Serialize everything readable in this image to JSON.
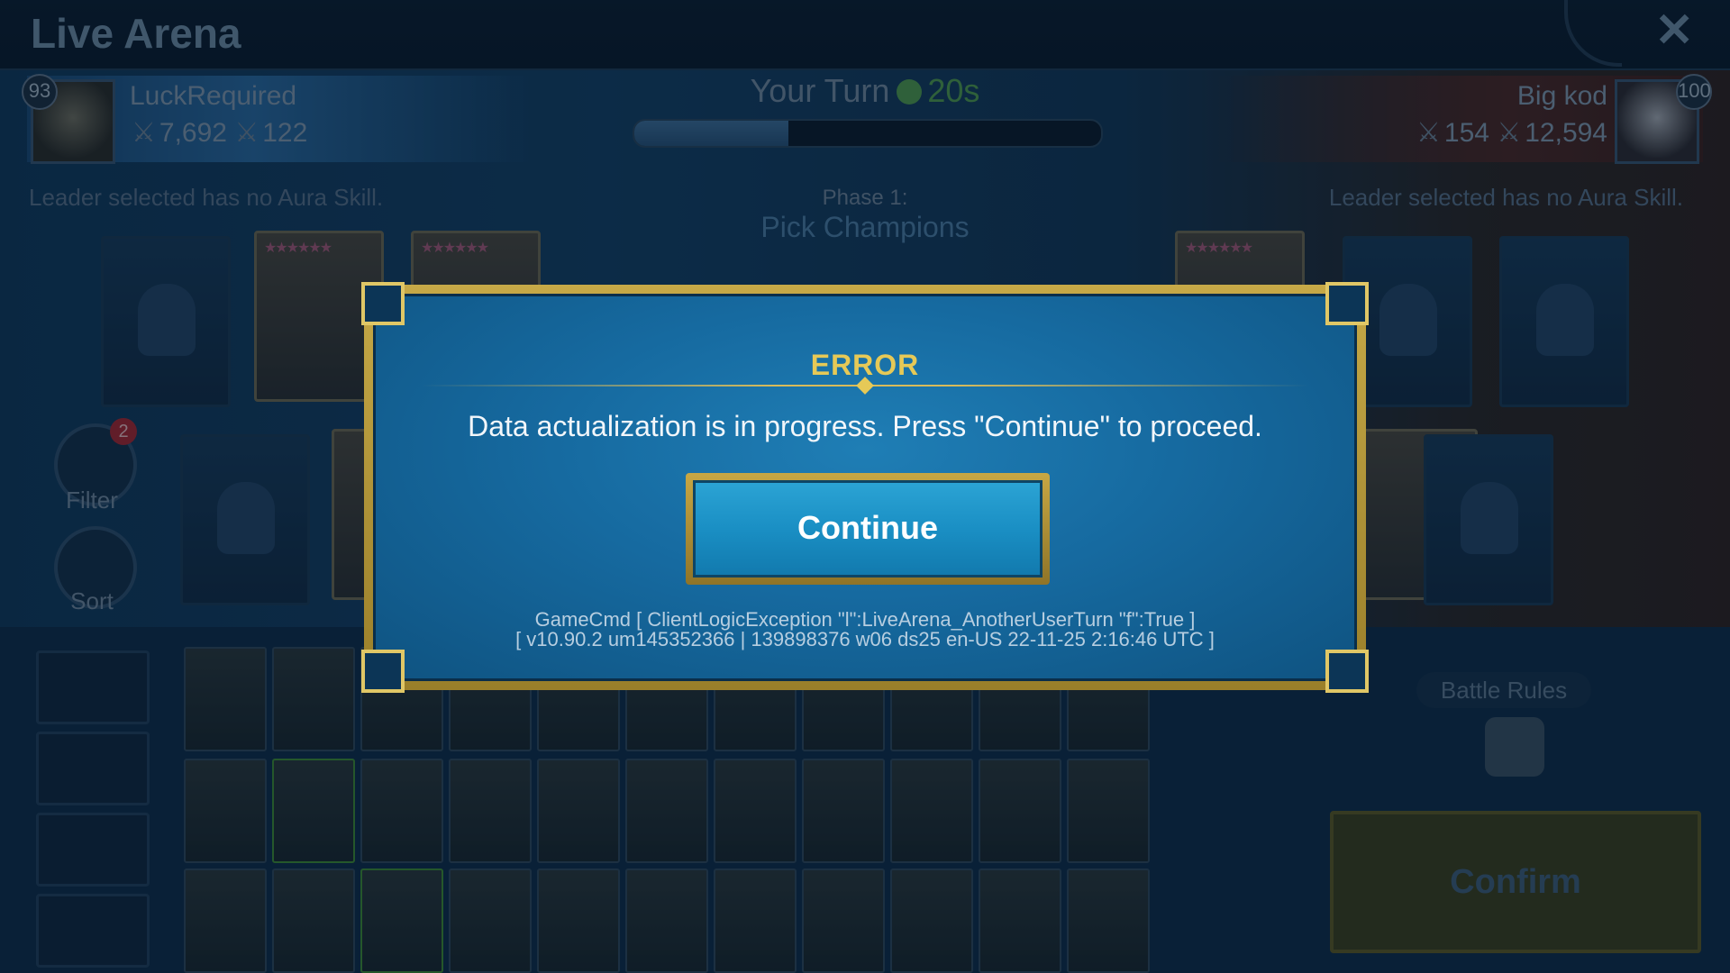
{
  "window": {
    "title": "Live Arena",
    "close_label": "✕"
  },
  "players": {
    "left": {
      "level": "93",
      "name": "LuckRequired",
      "power": "7,692",
      "arena": "122"
    },
    "right": {
      "level": "100",
      "name": "Big kod",
      "power": "154",
      "arena": "12,594"
    }
  },
  "turn": {
    "label": "Your Turn",
    "timer": "20s",
    "progress_fraction": 0.33
  },
  "phase": {
    "line1": "Phase 1:",
    "line2": "Pick Champions"
  },
  "aura_notice": "Leader selected has no Aura Skill.",
  "sidebar": {
    "filter_label": "Filter",
    "filter_badge": "2",
    "sort_label": "Sort"
  },
  "battle_rules_label": "Battle Rules",
  "confirm_label": "Confirm",
  "modal": {
    "title": "ERROR",
    "message": "Data actualization is in progress. Press \"Continue\" to proceed.",
    "button_label": "Continue",
    "debug_line1": "GameCmd [ ClientLogicException \"l\":LiveArena_AnotherUserTurn \"f\":True ]",
    "debug_line2": "[ v10.90.2  um145352366 | 139898376  w06  ds25  en-US  22-11-25 2:16:46 UTC ]"
  },
  "colors": {
    "gold": "#e6c957",
    "modal_blue": "#166aa0",
    "button_blue": "#1a8fc4",
    "timer_green": "#4f9a52"
  }
}
